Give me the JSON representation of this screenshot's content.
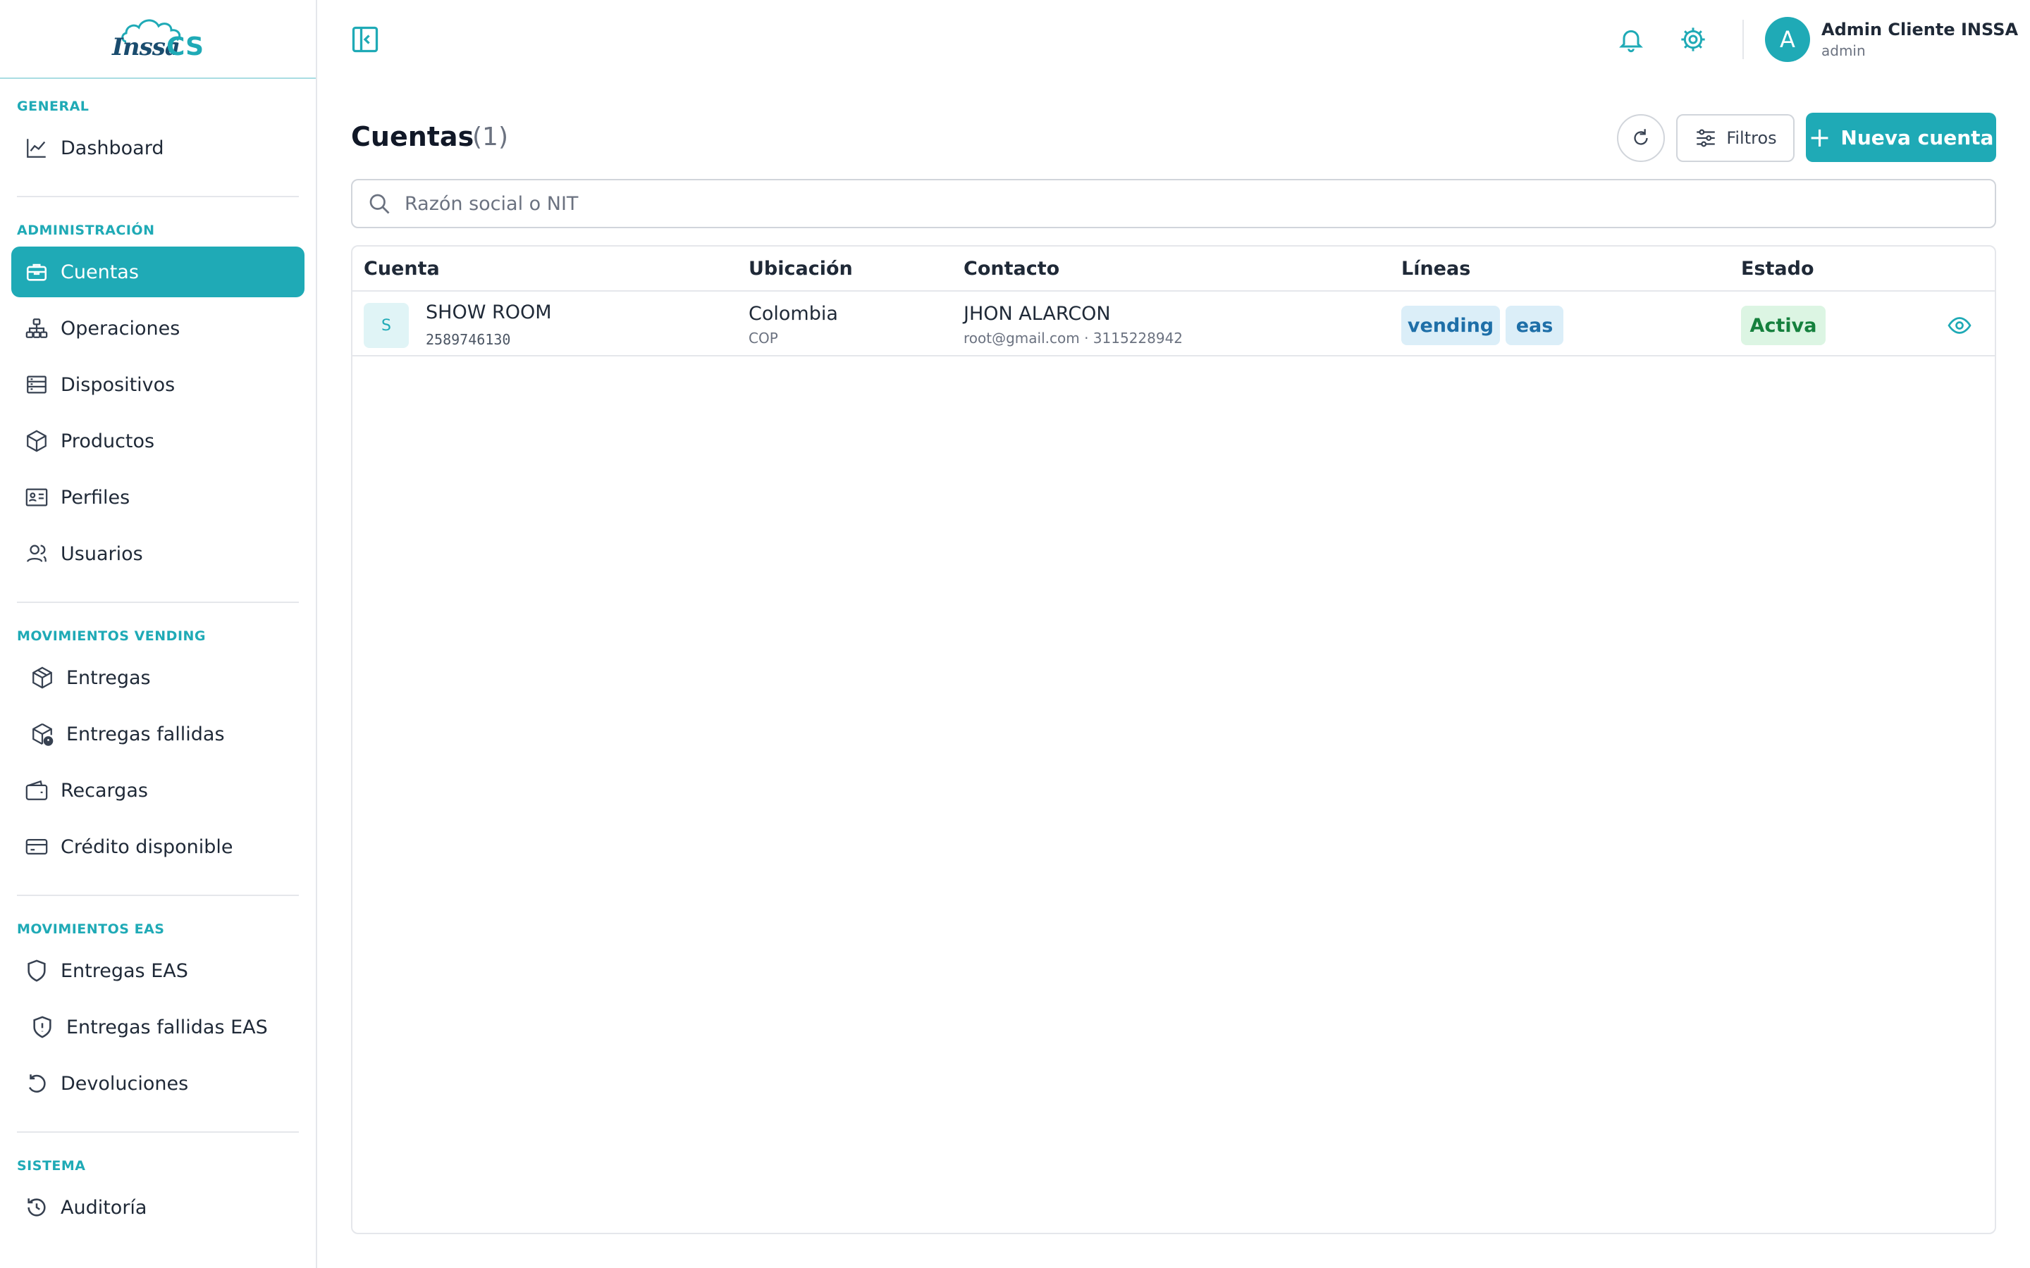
{
  "brand": {
    "logo_main": "Inssa",
    "logo_suffix": "CS"
  },
  "sidebar": {
    "sections": [
      {
        "title": "GENERAL",
        "items": [
          {
            "label": "Dashboard",
            "icon": "chart-line-icon"
          }
        ]
      },
      {
        "title": "ADMINISTRACIÓN",
        "items": [
          {
            "label": "Cuentas",
            "icon": "briefcase-icon",
            "active": true
          },
          {
            "label": "Operaciones",
            "icon": "sitemap-icon"
          },
          {
            "label": "Dispositivos",
            "icon": "server-icon"
          },
          {
            "label": "Productos",
            "icon": "box-icon"
          },
          {
            "label": "Perfiles",
            "icon": "id-card-icon"
          },
          {
            "label": "Usuarios",
            "icon": "users-icon"
          }
        ]
      },
      {
        "title": "MOVIMIENTOS VENDING",
        "items": [
          {
            "label": "Entregas",
            "icon": "package-icon"
          },
          {
            "label": "Entregas fallidas",
            "icon": "package-alert-icon"
          },
          {
            "label": "Recargas",
            "icon": "wallet-icon"
          },
          {
            "label": "Crédito disponible",
            "icon": "credit-card-icon"
          }
        ]
      },
      {
        "title": "MOVIMIENTOS EAS",
        "items": [
          {
            "label": "Entregas EAS",
            "icon": "shield-icon"
          },
          {
            "label": "Entregas fallidas EAS",
            "icon": "shield-alert-icon"
          },
          {
            "label": "Devoluciones",
            "icon": "undo-icon"
          }
        ]
      },
      {
        "title": "SISTEMA",
        "items": [
          {
            "label": "Auditoría",
            "icon": "history-icon"
          }
        ]
      }
    ]
  },
  "topbar": {
    "user": {
      "initial": "A",
      "name": "Admin Cliente INSSA",
      "role": "admin"
    }
  },
  "header": {
    "title": "Cuentas",
    "count": "(1)",
    "filters_label": "Filtros",
    "new_label": "Nueva cuenta"
  },
  "search": {
    "placeholder": "Razón social o NIT",
    "value": ""
  },
  "table": {
    "columns": [
      "Cuenta",
      "Ubicación",
      "Contacto",
      "Líneas",
      "Estado"
    ],
    "rows": [
      {
        "initial": "S",
        "name": "SHOW ROOM",
        "nit": "2589746130",
        "country": "Colombia",
        "currency": "COP",
        "contact_name": "JHON ALARCON",
        "contact_detail": "root@gmail.com · 3115228942",
        "lines": [
          "vending",
          "eas"
        ],
        "status": "Activa"
      }
    ]
  },
  "colors": {
    "accent": "#1faab6",
    "active_status": "#15803d",
    "tag_text": "#1e6fa8"
  }
}
